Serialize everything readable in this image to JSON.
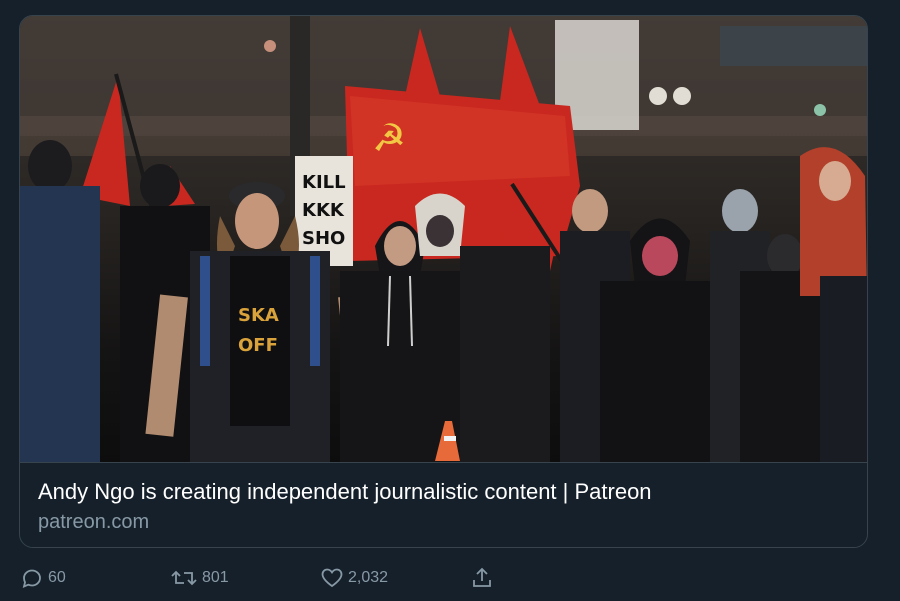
{
  "card": {
    "title": "Andy Ngo is creating independent journalistic content | Patreon",
    "domain": "patreon.com",
    "image_icon": "protest-photo"
  },
  "photo_text": {
    "sign_line1": "KILL",
    "sign_line2": "KKK",
    "sign_line3": "SHO",
    "shirt_line1": "SKA",
    "shirt_line2": "OFF"
  },
  "actions": {
    "reply": {
      "icon": "reply-icon",
      "count": "60"
    },
    "retweet": {
      "icon": "retweet-icon",
      "count": "801"
    },
    "like": {
      "icon": "heart-icon",
      "count": "2,032"
    },
    "share": {
      "icon": "share-icon"
    }
  },
  "colors": {
    "background": "#15202b",
    "border": "#38444d",
    "text_secondary": "#8899a6",
    "flag_red": "#c8281f"
  }
}
